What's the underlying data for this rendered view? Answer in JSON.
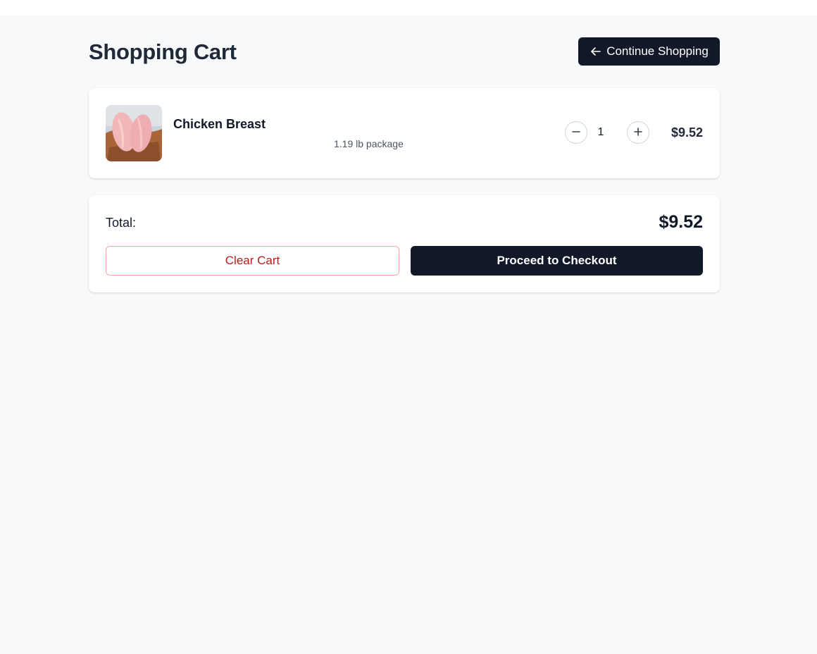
{
  "header": {
    "title": "Shopping Cart",
    "continue_label": "Continue Shopping"
  },
  "cart": {
    "items": [
      {
        "name": "Chicken Breast",
        "description": "1.19 lb package",
        "quantity": "1",
        "price": "$9.52",
        "image_icon": "chicken-breast-photo"
      }
    ]
  },
  "summary": {
    "total_label": "Total:",
    "total_value": "$9.52",
    "clear_label": "Clear Cart",
    "checkout_label": "Proceed to Checkout"
  },
  "colors": {
    "primary_dark": "#111827",
    "page_background": "#f8f9fb",
    "danger_text": "#b91c1c",
    "danger_border": "#fca5a5"
  }
}
